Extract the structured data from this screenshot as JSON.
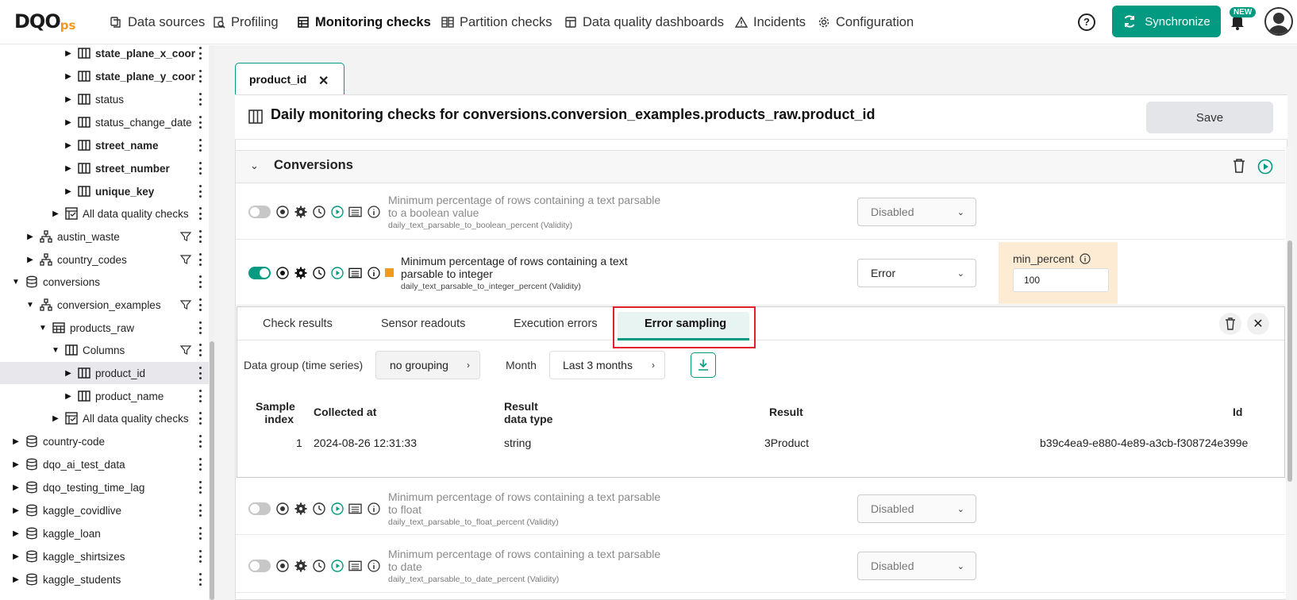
{
  "nav": {
    "logo_main": "DQO",
    "logo_sub": "ps",
    "items": [
      {
        "label": "Data sources",
        "icon": "data-sources-icon"
      },
      {
        "label": "Profiling",
        "icon": "profiling-icon"
      },
      {
        "label": "Monitoring checks",
        "icon": "monitoring-checks-icon"
      },
      {
        "label": "Partition checks",
        "icon": "partition-checks-icon"
      },
      {
        "label": "Data quality dashboards",
        "icon": "dashboard-icon"
      },
      {
        "label": "Incidents",
        "icon": "warning-icon"
      },
      {
        "label": "Configuration",
        "icon": "gear-icon"
      }
    ],
    "help": "?",
    "sync_label": "Synchronize",
    "new_badge": "NEW",
    "accent_color": "#029a80"
  },
  "sidebar": {
    "rows": [
      {
        "label": "state_plane_x_coord",
        "bold": true
      },
      {
        "label": "state_plane_y_coord",
        "bold": true
      },
      {
        "label": "status",
        "bold": false
      },
      {
        "label": "status_change_date",
        "bold": false
      },
      {
        "label": "street_name",
        "bold": true
      },
      {
        "label": "street_number",
        "bold": true
      },
      {
        "label": "unique_key",
        "bold": true
      },
      {
        "label": "All data quality checks",
        "bold": false
      },
      {
        "label": "austin_waste",
        "bold": false
      },
      {
        "label": "country_codes",
        "bold": false
      },
      {
        "label": "conversions",
        "bold": false
      },
      {
        "label": "conversion_examples",
        "bold": false
      },
      {
        "label": "products_raw",
        "bold": false
      },
      {
        "label": "Columns",
        "bold": false
      },
      {
        "label": "product_id",
        "bold": false
      },
      {
        "label": "product_name",
        "bold": false
      },
      {
        "label": "All data quality checks",
        "bold": false
      },
      {
        "label": "country-code",
        "bold": false
      },
      {
        "label": "dqo_ai_test_data",
        "bold": false
      },
      {
        "label": "dqo_testing_time_lag",
        "bold": false
      },
      {
        "label": "kaggle_covidlive",
        "bold": false
      },
      {
        "label": "kaggle_loan",
        "bold": false
      },
      {
        "label": "kaggle_shirtsizes",
        "bold": false
      },
      {
        "label": "kaggle_students",
        "bold": false
      }
    ]
  },
  "main": {
    "tab_label": "product_id",
    "title": "Daily monitoring checks for conversions.conversion_examples.products_raw.product_id",
    "save_label": "Save",
    "group_title": "Conversions",
    "checks": [
      {
        "desc1": "Minimum percentage of rows containing a text parsable",
        "desc2": "to a boolean value",
        "sub": "daily_text_parsable_to_boolean_percent (Validity)",
        "severity": "Disabled"
      },
      {
        "desc1": "Minimum percentage of rows containing a text",
        "desc2": "parsable to integer",
        "sub": "daily_text_parsable_to_integer_percent (Validity)",
        "severity": "Error"
      },
      {
        "desc1": "Minimum percentage of rows containing a text parsable",
        "desc2": "to float",
        "sub": "daily_text_parsable_to_float_percent (Validity)",
        "severity": "Disabled"
      },
      {
        "desc1": "Minimum percentage of rows containing a text parsable",
        "desc2": "to date",
        "sub": "daily_text_parsable_to_date_percent (Validity)",
        "severity": "Disabled"
      }
    ],
    "param": {
      "label": "min_percent",
      "value": "100"
    }
  },
  "results": {
    "tabs": [
      "Check results",
      "Sensor readouts",
      "Execution errors",
      "Error sampling"
    ],
    "active_tab": "Error sampling",
    "data_group_label": "Data group (time series)",
    "data_group_value": "no grouping",
    "month_label": "Month",
    "month_value": "Last 3 months",
    "columns": {
      "sample_index_1": "Sample",
      "sample_index_2": "index",
      "collected_at": "Collected at",
      "result_type_1": "Result",
      "result_type_2": "data type",
      "result": "Result",
      "id": "Id"
    },
    "rows": [
      {
        "index": "1",
        "collected_at": "2024-08-26 12:31:33",
        "type": "string",
        "result": "3Product",
        "id": "b39c4ea9-e880-4e89-a3cb-f308724e399e"
      }
    ]
  }
}
